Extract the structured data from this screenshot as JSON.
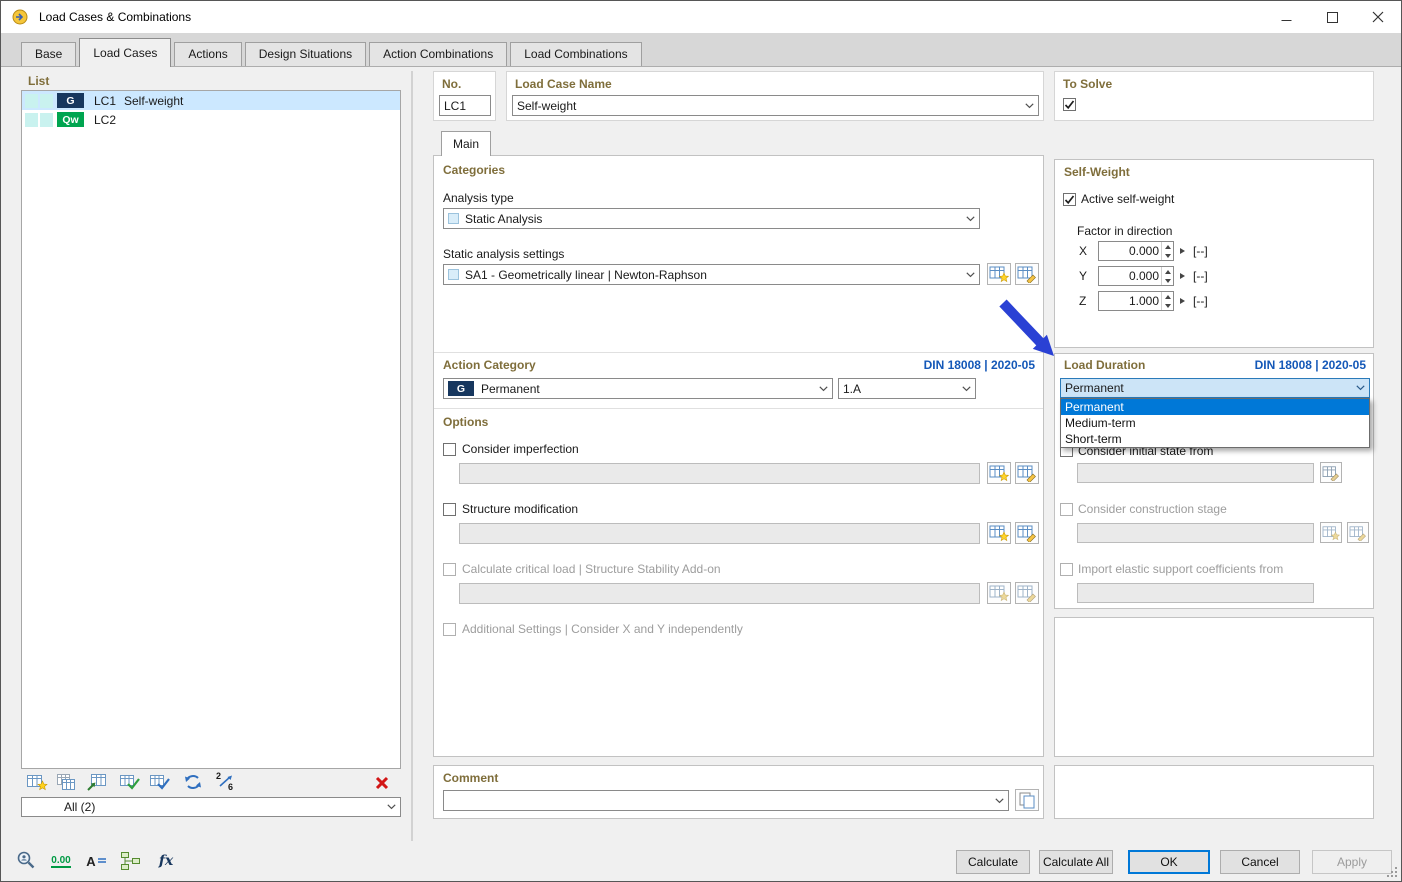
{
  "titlebar": {
    "title": "Load Cases & Combinations"
  },
  "tabs": {
    "items": [
      "Base",
      "Load Cases",
      "Actions",
      "Design Situations",
      "Action Combinations",
      "Load Combinations"
    ],
    "active": "Load Cases"
  },
  "list_panel": {
    "title": "List",
    "rows": [
      {
        "badge": "G",
        "badge_color": "#17375e",
        "id": "LC1",
        "name": "Self-weight",
        "selected": true
      },
      {
        "badge": "Qw",
        "badge_color": "#00a550",
        "id": "LC2",
        "name": "",
        "selected": false
      }
    ],
    "filter_value": "All (2)"
  },
  "header": {
    "no": {
      "label": "No.",
      "value": "LC1"
    },
    "name": {
      "label": "Load Case Name",
      "value": "Self-weight"
    },
    "to_solve": {
      "label": "To Solve",
      "checked": true
    }
  },
  "main_tab": {
    "label": "Main"
  },
  "categories": {
    "title": "Categories",
    "analysis_type_label": "Analysis type",
    "analysis_type_value": "Static Analysis",
    "settings_label": "Static analysis settings",
    "settings_value": "SA1 - Geometrically linear | Newton-Raphson"
  },
  "action_category": {
    "title": "Action Category",
    "standard": "DIN 18008 | 2020-05",
    "badge": "G",
    "value": "Permanent",
    "combination_value": "1.A"
  },
  "options": {
    "title": "Options",
    "imperfection_label": "Consider imperfection",
    "structure_label": "Structure modification",
    "critical_label": "Calculate critical load | Structure Stability Add-on",
    "additional_label": "Additional Settings | Consider X and Y independently"
  },
  "comment": {
    "title": "Comment",
    "value": ""
  },
  "self_weight": {
    "title": "Self-Weight",
    "active_label": "Active self-weight",
    "factor_label": "Factor in direction",
    "rows": [
      {
        "axis": "X",
        "value": "0.000",
        "unit": "[--]"
      },
      {
        "axis": "Y",
        "value": "0.000",
        "unit": "[--]"
      },
      {
        "axis": "Z",
        "value": "1.000",
        "unit": "[--]"
      }
    ]
  },
  "load_duration": {
    "title": "Load Duration",
    "standard": "DIN 18008 | 2020-05",
    "value": "Permanent",
    "options": [
      "Permanent",
      "Medium-term",
      "Short-term"
    ],
    "selected": "Permanent",
    "initial_state_label": "Consider initial state from",
    "construction_label": "Consider construction stage",
    "import_label": "Import elastic support coefficients from"
  },
  "footer": {
    "calculate": "Calculate",
    "calculate_all": "Calculate All",
    "ok": "OK",
    "cancel": "Cancel",
    "apply": "Apply"
  },
  "icons": {
    "decimals_text": "0.00",
    "display_letter": "A",
    "formula_text": "fx",
    "renumber_digits": [
      "2",
      "6"
    ],
    "accent_blue": "#0078d7",
    "selection_blue": "#cce8ff",
    "annotation_arrow_color": "#2a41d4"
  }
}
